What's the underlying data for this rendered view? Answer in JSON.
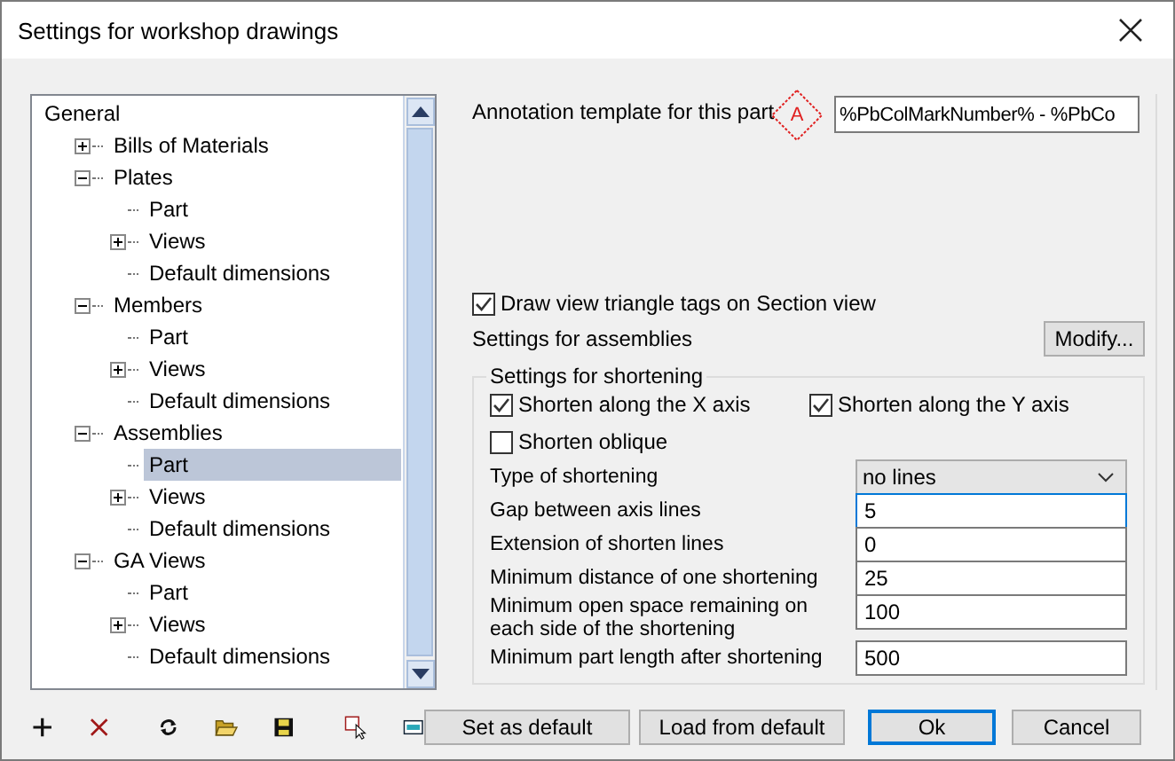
{
  "window": {
    "title": "Settings for workshop drawings"
  },
  "tree": [
    {
      "label": "General",
      "selected": false,
      "children": [
        {
          "label": "Bills of Materials",
          "selected": false,
          "expanded": false
        },
        {
          "label": "Plates",
          "selected": false,
          "expanded": true,
          "children": [
            {
              "label": "Part",
              "selected": false
            },
            {
              "label": "Views",
              "selected": false,
              "expanded": false
            },
            {
              "label": "Default dimensions",
              "selected": false
            }
          ]
        },
        {
          "label": "Members",
          "selected": false,
          "expanded": true,
          "children": [
            {
              "label": "Part",
              "selected": false
            },
            {
              "label": "Views",
              "selected": false,
              "expanded": false
            },
            {
              "label": "Default dimensions",
              "selected": false
            }
          ]
        },
        {
          "label": "Assemblies",
          "selected": false,
          "expanded": true,
          "children": [
            {
              "label": "Part",
              "selected": true
            },
            {
              "label": "Views",
              "selected": false,
              "expanded": false
            },
            {
              "label": "Default dimensions",
              "selected": false
            }
          ]
        },
        {
          "label": "GA Views",
          "selected": false,
          "expanded": true,
          "children": [
            {
              "label": "Part",
              "selected": false
            },
            {
              "label": "Views",
              "selected": false,
              "expanded": false
            },
            {
              "label": "Default dimensions",
              "selected": false
            }
          ]
        }
      ]
    }
  ],
  "annotation": {
    "label": "Annotation template for this part",
    "tag": "A",
    "value": "%PbColMarkNumber% - %PbCo"
  },
  "triangle_tags": {
    "label": "Draw view triangle tags on Section view",
    "checked": true
  },
  "assemblies": {
    "label": "Settings for assemblies",
    "button": "Modify..."
  },
  "shortening": {
    "title": "Settings for shortening",
    "checkboxes": [
      {
        "label": "Shorten along the X axis",
        "checked": true
      },
      {
        "label": "Shorten along the Y axis",
        "checked": true
      },
      {
        "label": "Shorten oblique",
        "checked": false
      }
    ],
    "fields": [
      {
        "kind": "dropdown",
        "label": "Type of shortening",
        "value": "no lines",
        "focused": false
      },
      {
        "kind": "input",
        "label": "Gap between axis lines",
        "value": "5",
        "focused": true
      },
      {
        "kind": "input",
        "label": "Extension of shorten lines",
        "value": "0",
        "focused": false
      },
      {
        "kind": "input",
        "label": "Minimum distance of one shortening",
        "value": "25",
        "focused": false
      },
      {
        "kind": "input",
        "label": "Minimum open space remaining on each side of the shortening",
        "value": "100",
        "focused": false
      },
      {
        "kind": "input",
        "label": "Minimum part length after shortening",
        "value": "500",
        "focused": false
      }
    ]
  },
  "buttons": [
    {
      "label": "Set as default",
      "default": false
    },
    {
      "label": "Load from default",
      "default": false
    },
    {
      "label": "Ok",
      "default": true
    },
    {
      "label": "Cancel",
      "default": false
    }
  ]
}
